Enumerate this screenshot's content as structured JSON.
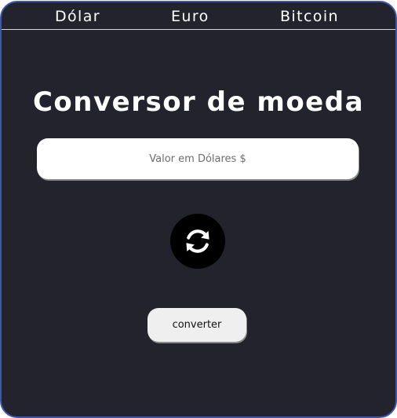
{
  "nav": {
    "items": [
      {
        "label": "Dólar"
      },
      {
        "label": "Euro"
      },
      {
        "label": "Bitcoin"
      }
    ]
  },
  "title": "Conversor de moeda",
  "input": {
    "value": "",
    "placeholder": "Valor em Dólares $"
  },
  "swap_icon": "refresh-arrows-icon",
  "convert_label": "converter",
  "colors": {
    "background": "#23232e",
    "border": "#3a5aa6",
    "input_bg": "#ffffff",
    "button_bg": "#efefef",
    "swap_bg": "#000000"
  }
}
